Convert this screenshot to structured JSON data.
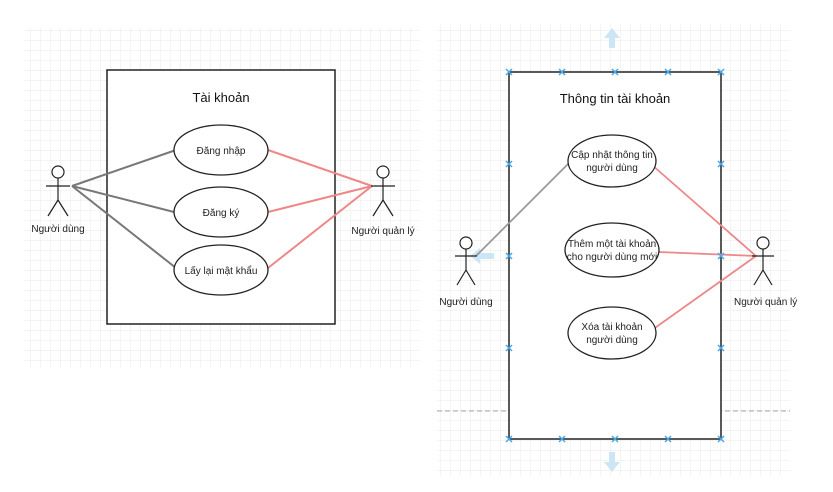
{
  "left": {
    "system_title": "Tài khoản",
    "use_cases": [
      "Đăng nhập",
      "Đăng ký",
      "Lấy lại mật khẩu"
    ],
    "actor_user": "Người dùng",
    "actor_admin": "Người quản lý"
  },
  "right": {
    "system_title": "Thông tin tài khoản",
    "use_case_1": [
      "Cập nhật thông tin",
      "người dùng"
    ],
    "use_case_2": [
      "Thêm một tài khoản",
      "cho người dùng mới"
    ],
    "use_case_3": [
      "Xóa tài khoản",
      "người dùng"
    ],
    "actor_user": "Người dùng",
    "actor_admin": "Người quản lý"
  },
  "colors": {
    "grid_line": "#e6e6e6",
    "box_border": "#222222",
    "user_link": "#777777",
    "admin_link": "#ee8888",
    "selection_handle": "#4aa8e8"
  }
}
